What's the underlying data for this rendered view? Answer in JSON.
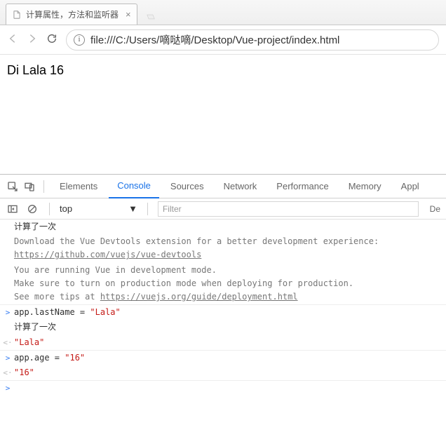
{
  "browser": {
    "tabTitle": "计算属性，方法和监听器",
    "url": "file:///C:/Users/嘀哒嘀/Desktop/Vue-project/index.html"
  },
  "page": {
    "content": "Di Lala 16"
  },
  "devtools": {
    "tabs": {
      "elements": "Elements",
      "console": "Console",
      "sources": "Sources",
      "network": "Network",
      "performance": "Performance",
      "memory": "Memory",
      "application": "Appl"
    },
    "context": "top",
    "filterPlaceholder": "Filter",
    "defaultLabel": "De"
  },
  "console": {
    "lines": [
      {
        "gutter": "",
        "kind": "log",
        "text": "计算了一次"
      },
      {
        "gutter": "",
        "kind": "info",
        "html": "Download the Vue Devtools extension for a better development experience:\n<span class=\"link\">https://github.com/vuejs/vue-devtools</span>"
      },
      {
        "gutter": "",
        "kind": "info",
        "html": "You are running Vue in development mode.\nMake sure to turn on production mode when deploying for production.\nSee more tips at <span class=\"link\">https://vuejs.org/guide/deployment.html</span>",
        "sep": true
      },
      {
        "gutter": ">",
        "kind": "in",
        "html": "app.lastName = <span class=\"str\">\"Lala\"</span>"
      },
      {
        "gutter": "",
        "kind": "log",
        "text": "计算了一次"
      },
      {
        "gutter": "<·",
        "kind": "out",
        "html": "<span class=\"str\">\"Lala\"</span>",
        "sep": true
      },
      {
        "gutter": ">",
        "kind": "in",
        "html": "app.age = <span class=\"str\">\"16\"</span>"
      },
      {
        "gutter": "<·",
        "kind": "out",
        "html": "<span class=\"str\">\"16\"</span>",
        "sep": true
      },
      {
        "gutter": ">",
        "kind": "blank",
        "text": ""
      }
    ]
  }
}
